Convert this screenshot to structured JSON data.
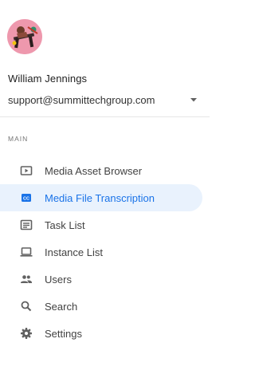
{
  "user": {
    "name": "William Jennings",
    "email": "support@summittechgroup.com"
  },
  "icons": {
    "dropdown": "arrow-drop-down-icon"
  },
  "section": {
    "label": "MAIN"
  },
  "nav": {
    "items": [
      {
        "label": "Media Asset Browser",
        "icon": "video-library-icon",
        "active": false
      },
      {
        "label": "Media File Transcription",
        "icon": "closed-caption-icon",
        "active": true
      },
      {
        "label": "Task List",
        "icon": "subtitles-icon",
        "active": false
      },
      {
        "label": "Instance List",
        "icon": "laptop-icon",
        "active": false
      },
      {
        "label": "Users",
        "icon": "people-icon",
        "active": false
      },
      {
        "label": "Search",
        "icon": "search-icon",
        "active": false
      },
      {
        "label": "Settings",
        "icon": "gear-icon",
        "active": false
      }
    ]
  },
  "colors": {
    "accent": "#1a73e8",
    "active_bg": "#e9f2fd",
    "divider": "#e6e6e6",
    "avatar_bg": "#ef9bb0"
  }
}
